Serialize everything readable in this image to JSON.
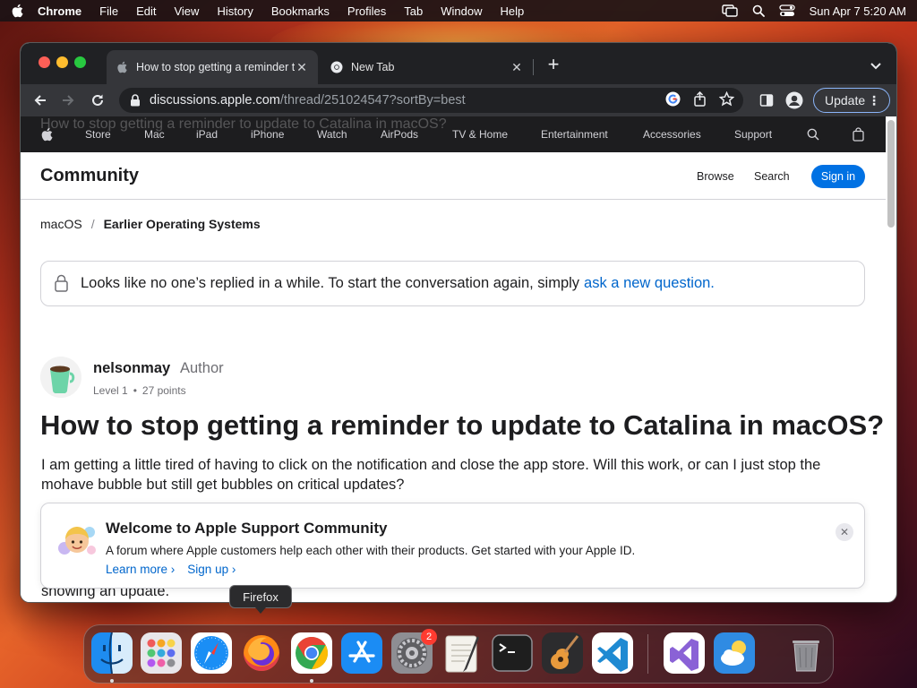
{
  "menubar": {
    "app_name": "Chrome",
    "items": [
      "File",
      "Edit",
      "View",
      "History",
      "Bookmarks",
      "Profiles",
      "Tab",
      "Window",
      "Help"
    ],
    "clock": "Sun Apr 7  5:20 AM"
  },
  "browser": {
    "tabs": [
      {
        "title": "How to stop getting a reminder to update to Catalina in macOS?",
        "active": true
      },
      {
        "title": "New Tab",
        "active": false
      }
    ],
    "url_host": "discussions.apple.com",
    "url_path": "/thread/251024547?sortBy=best",
    "update_label": "Update"
  },
  "apple_nav": {
    "ghost_text": "How to stop getting a reminder to update to Catalina in macOS?",
    "items": [
      "Store",
      "Mac",
      "iPad",
      "iPhone",
      "Watch",
      "AirPods",
      "TV & Home",
      "Entertainment",
      "Accessories",
      "Support"
    ]
  },
  "community": {
    "title": "Community",
    "browse": "Browse",
    "search": "Search",
    "signin": "Sign in"
  },
  "breadcrumb": {
    "root": "macOS",
    "separator": "/",
    "current": "Earlier Operating Systems"
  },
  "notice": {
    "text": "Looks like no one’s replied in a while. To start the conversation again, simply",
    "link": "ask a new question."
  },
  "post": {
    "author": "nelsonmay",
    "role": "Author",
    "level": "Level 1",
    "dot": "•",
    "points": "27 points",
    "title": "How to stop getting a reminder to update to Catalina in macOS?",
    "body": "I am getting a little tired of having to click on the notification and close the app store. Will this work, or can I just stop the mohave bubble but still get bubbles on critical updates?",
    "peek": "showing an update."
  },
  "welcome": {
    "title": "Welcome to Apple Support Community",
    "text": "A forum where Apple customers help each other with their products. Get started with your Apple ID.",
    "learn_more": "Learn more ›",
    "sign_up": "Sign up ›"
  },
  "dock": {
    "tooltip": "Firefox",
    "apps": [
      "finder-icon",
      "launchpad-icon",
      "safari-icon",
      "firefox-icon",
      "chrome-icon",
      "app-store-icon",
      "system-settings-icon",
      "textedit-icon",
      "terminal-icon",
      "garageband-icon",
      "vscode-icon",
      "visual-studio-icon",
      "weather-icon",
      "trash-icon"
    ],
    "settings_badge": "2"
  },
  "colors": {
    "accent": "#0071e3",
    "link": "#0066cc",
    "chrome_dark": "#202124"
  }
}
